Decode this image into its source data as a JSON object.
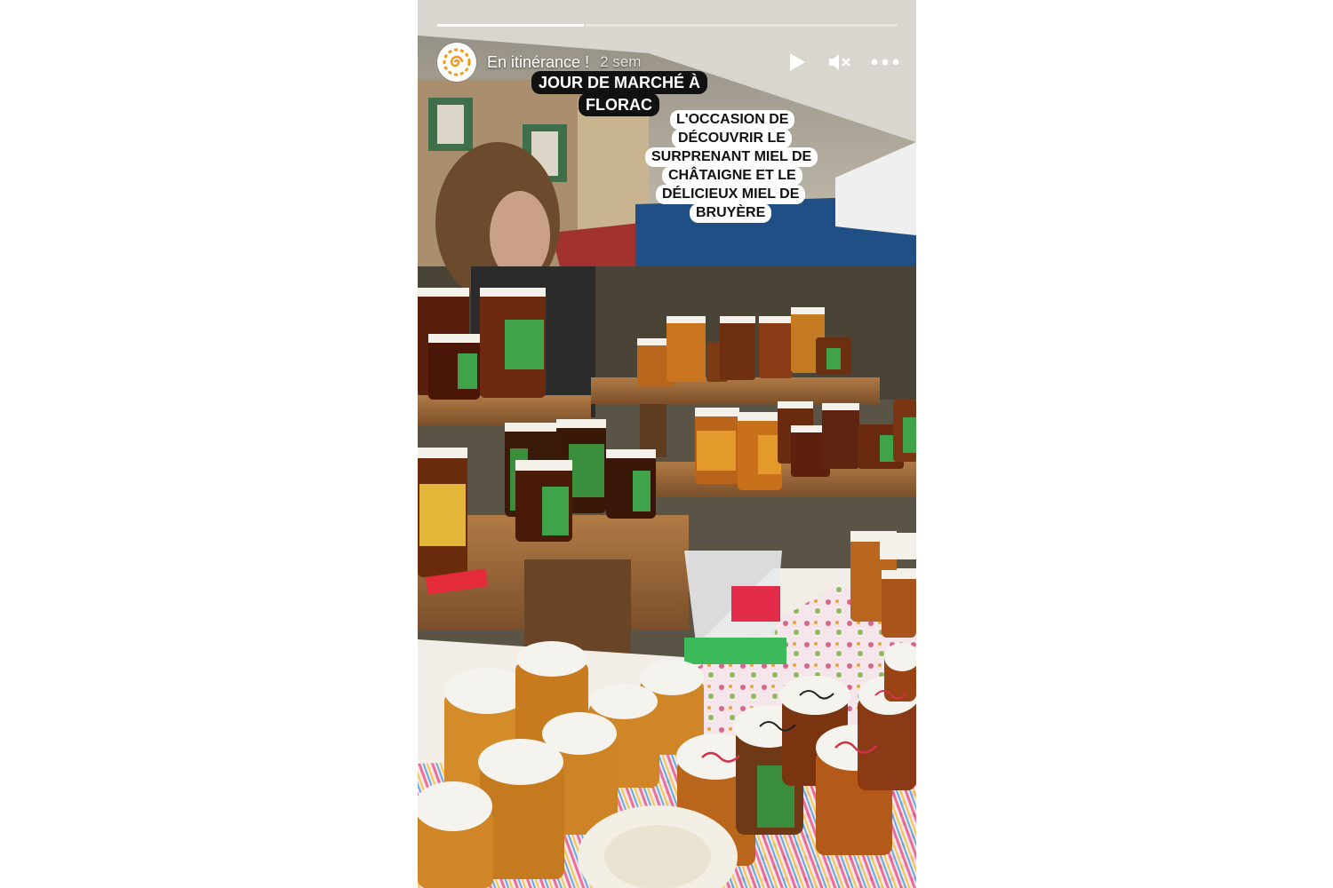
{
  "story": {
    "account_name": "En itinérance !",
    "time_ago": "2 sem",
    "progress": {
      "segments": 2,
      "current": 1,
      "fraction": 0.32
    },
    "avatar_icon": "orange-spiral-logo",
    "controls": {
      "play_icon": "play-icon",
      "mute_icon": "muted-speaker-icon",
      "more_icon": "more-horizontal-icon"
    }
  },
  "captions": {
    "title_line1": "JOUR DE MARCHÉ À",
    "title_line2": "FLORAC",
    "body_lines": [
      "L'OCCASION DE",
      "DÉCOUVRIR LE",
      "SURPRENANT MIEL DE",
      "CHÂTAIGNE ET LE",
      "DÉLICIEUX MIEL DE",
      "BRUYÈRE"
    ]
  },
  "colors": {
    "caption_dark": "#111111",
    "caption_light": "#ffffff",
    "brand_orange": "#f29a1f"
  }
}
